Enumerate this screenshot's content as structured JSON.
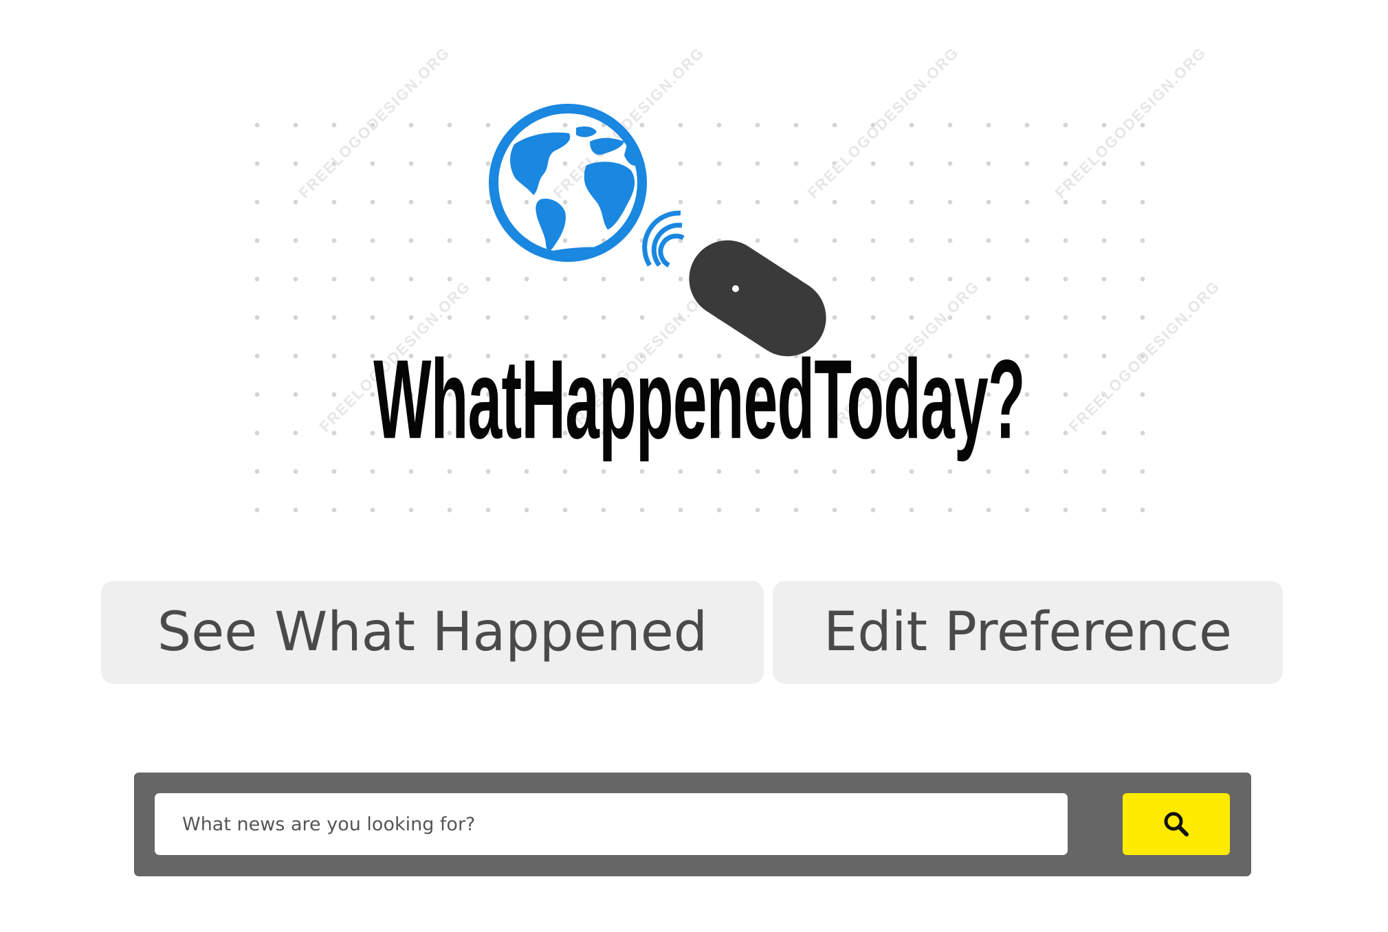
{
  "logo": {
    "wordmark": "WhatHappenedToday?",
    "watermark_text": "FREELOGODESIGN.ORG",
    "colors": {
      "globe": "#1a87e0",
      "mouse": "#3a3a3a",
      "wordmark": "#050505"
    }
  },
  "nav": {
    "see_label": "See What Happened",
    "edit_label": "Edit Preference"
  },
  "search": {
    "placeholder": "What news are you looking for?",
    "value": "",
    "button_icon": "search-icon",
    "bar_color": "#666666",
    "button_color": "#ffeb00"
  }
}
